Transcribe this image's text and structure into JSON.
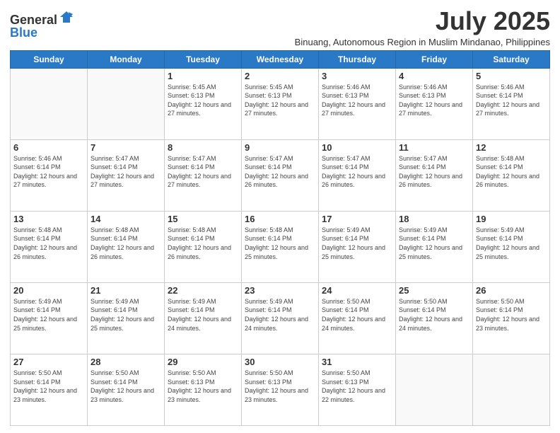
{
  "logo": {
    "general": "General",
    "blue": "Blue"
  },
  "title": "July 2025",
  "subtitle": "Binuang, Autonomous Region in Muslim Mindanao, Philippines",
  "weekdays": [
    "Sunday",
    "Monday",
    "Tuesday",
    "Wednesday",
    "Thursday",
    "Friday",
    "Saturday"
  ],
  "weeks": [
    [
      {
        "day": "",
        "info": ""
      },
      {
        "day": "",
        "info": ""
      },
      {
        "day": "1",
        "info": "Sunrise: 5:45 AM\nSunset: 6:13 PM\nDaylight: 12 hours and 27 minutes."
      },
      {
        "day": "2",
        "info": "Sunrise: 5:45 AM\nSunset: 6:13 PM\nDaylight: 12 hours and 27 minutes."
      },
      {
        "day": "3",
        "info": "Sunrise: 5:46 AM\nSunset: 6:13 PM\nDaylight: 12 hours and 27 minutes."
      },
      {
        "day": "4",
        "info": "Sunrise: 5:46 AM\nSunset: 6:13 PM\nDaylight: 12 hours and 27 minutes."
      },
      {
        "day": "5",
        "info": "Sunrise: 5:46 AM\nSunset: 6:14 PM\nDaylight: 12 hours and 27 minutes."
      }
    ],
    [
      {
        "day": "6",
        "info": "Sunrise: 5:46 AM\nSunset: 6:14 PM\nDaylight: 12 hours and 27 minutes."
      },
      {
        "day": "7",
        "info": "Sunrise: 5:47 AM\nSunset: 6:14 PM\nDaylight: 12 hours and 27 minutes."
      },
      {
        "day": "8",
        "info": "Sunrise: 5:47 AM\nSunset: 6:14 PM\nDaylight: 12 hours and 27 minutes."
      },
      {
        "day": "9",
        "info": "Sunrise: 5:47 AM\nSunset: 6:14 PM\nDaylight: 12 hours and 26 minutes."
      },
      {
        "day": "10",
        "info": "Sunrise: 5:47 AM\nSunset: 6:14 PM\nDaylight: 12 hours and 26 minutes."
      },
      {
        "day": "11",
        "info": "Sunrise: 5:47 AM\nSunset: 6:14 PM\nDaylight: 12 hours and 26 minutes."
      },
      {
        "day": "12",
        "info": "Sunrise: 5:48 AM\nSunset: 6:14 PM\nDaylight: 12 hours and 26 minutes."
      }
    ],
    [
      {
        "day": "13",
        "info": "Sunrise: 5:48 AM\nSunset: 6:14 PM\nDaylight: 12 hours and 26 minutes."
      },
      {
        "day": "14",
        "info": "Sunrise: 5:48 AM\nSunset: 6:14 PM\nDaylight: 12 hours and 26 minutes."
      },
      {
        "day": "15",
        "info": "Sunrise: 5:48 AM\nSunset: 6:14 PM\nDaylight: 12 hours and 26 minutes."
      },
      {
        "day": "16",
        "info": "Sunrise: 5:48 AM\nSunset: 6:14 PM\nDaylight: 12 hours and 25 minutes."
      },
      {
        "day": "17",
        "info": "Sunrise: 5:49 AM\nSunset: 6:14 PM\nDaylight: 12 hours and 25 minutes."
      },
      {
        "day": "18",
        "info": "Sunrise: 5:49 AM\nSunset: 6:14 PM\nDaylight: 12 hours and 25 minutes."
      },
      {
        "day": "19",
        "info": "Sunrise: 5:49 AM\nSunset: 6:14 PM\nDaylight: 12 hours and 25 minutes."
      }
    ],
    [
      {
        "day": "20",
        "info": "Sunrise: 5:49 AM\nSunset: 6:14 PM\nDaylight: 12 hours and 25 minutes."
      },
      {
        "day": "21",
        "info": "Sunrise: 5:49 AM\nSunset: 6:14 PM\nDaylight: 12 hours and 25 minutes."
      },
      {
        "day": "22",
        "info": "Sunrise: 5:49 AM\nSunset: 6:14 PM\nDaylight: 12 hours and 24 minutes."
      },
      {
        "day": "23",
        "info": "Sunrise: 5:49 AM\nSunset: 6:14 PM\nDaylight: 12 hours and 24 minutes."
      },
      {
        "day": "24",
        "info": "Sunrise: 5:50 AM\nSunset: 6:14 PM\nDaylight: 12 hours and 24 minutes."
      },
      {
        "day": "25",
        "info": "Sunrise: 5:50 AM\nSunset: 6:14 PM\nDaylight: 12 hours and 24 minutes."
      },
      {
        "day": "26",
        "info": "Sunrise: 5:50 AM\nSunset: 6:14 PM\nDaylight: 12 hours and 23 minutes."
      }
    ],
    [
      {
        "day": "27",
        "info": "Sunrise: 5:50 AM\nSunset: 6:14 PM\nDaylight: 12 hours and 23 minutes."
      },
      {
        "day": "28",
        "info": "Sunrise: 5:50 AM\nSunset: 6:14 PM\nDaylight: 12 hours and 23 minutes."
      },
      {
        "day": "29",
        "info": "Sunrise: 5:50 AM\nSunset: 6:13 PM\nDaylight: 12 hours and 23 minutes."
      },
      {
        "day": "30",
        "info": "Sunrise: 5:50 AM\nSunset: 6:13 PM\nDaylight: 12 hours and 23 minutes."
      },
      {
        "day": "31",
        "info": "Sunrise: 5:50 AM\nSunset: 6:13 PM\nDaylight: 12 hours and 22 minutes."
      },
      {
        "day": "",
        "info": ""
      },
      {
        "day": "",
        "info": ""
      }
    ]
  ]
}
